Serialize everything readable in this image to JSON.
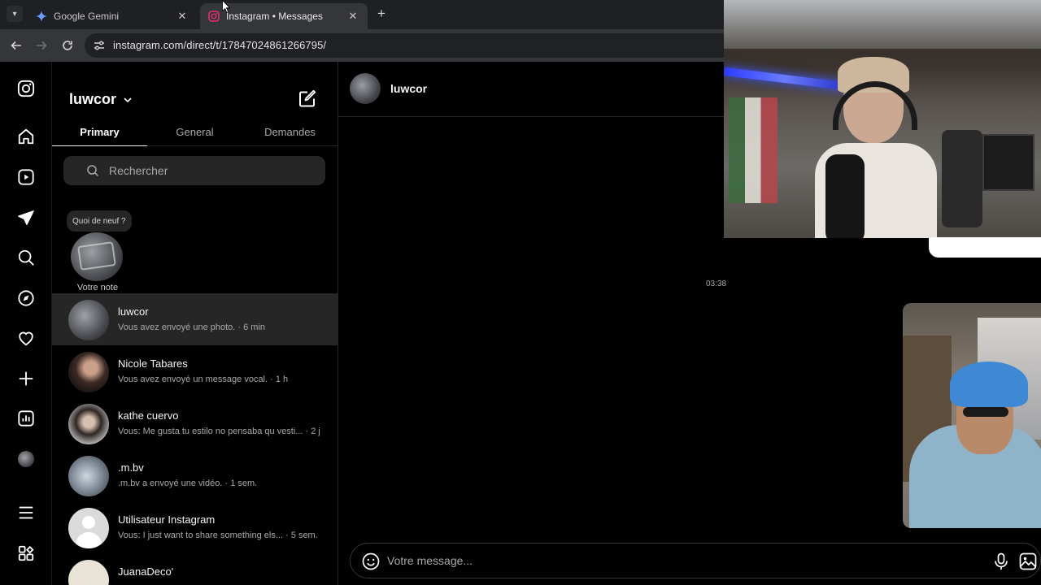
{
  "browser": {
    "tabs": [
      {
        "title": "Google Gemini",
        "favicon": "gemini-star-icon",
        "active": false
      },
      {
        "title": "Instagram • Messages",
        "favicon": "instagram-icon",
        "active": true
      }
    ],
    "url": "instagram.com/direct/t/17847024861266795/"
  },
  "nav": {
    "items": [
      "instagram-logo",
      "home-icon",
      "reels-icon",
      "messages-icon",
      "search-icon",
      "explore-icon",
      "heart-icon",
      "create-icon",
      "dashboard-icon",
      "profile-avatar",
      "menu-icon",
      "apps-icon"
    ]
  },
  "inbox": {
    "account": "luwcor",
    "tabs": [
      "Primary",
      "General",
      "Demandes"
    ],
    "active_tab": "Primary",
    "search_placeholder": "Rechercher",
    "note": {
      "bubble": "Quoi de neuf ?",
      "label": "Votre note"
    },
    "threads": [
      {
        "name": "luwcor",
        "preview": "Vous avez envoyé une photo. · 6 min",
        "selected": true
      },
      {
        "name": "Nicole Tabares",
        "preview": "Vous avez envoyé un message vocal. · 1 h",
        "selected": false
      },
      {
        "name": "kathe cuervo",
        "preview": "Vous: Me gusta tu estilo no pensaba qu vesti... · 2 j",
        "selected": false
      },
      {
        "name": ".m.bv",
        "preview": ".m.bv a envoyé une vidéo. · 1 sem.",
        "selected": false
      },
      {
        "name": "Utilisateur Instagram",
        "preview": "Vous: I just want to share something els... · 5 sem.",
        "selected": false
      },
      {
        "name": "JuanaDeco'",
        "preview": "",
        "selected": false
      }
    ]
  },
  "conversation": {
    "name": "luwcor",
    "timestamp": "03:38",
    "composer_placeholder": "Votre message..."
  },
  "colors": {
    "bg": "#000000",
    "panel": "#262626",
    "muted": "#a8a8a8",
    "chrome_tabbar": "#1f2023",
    "chrome_toolbar": "#35363a"
  }
}
